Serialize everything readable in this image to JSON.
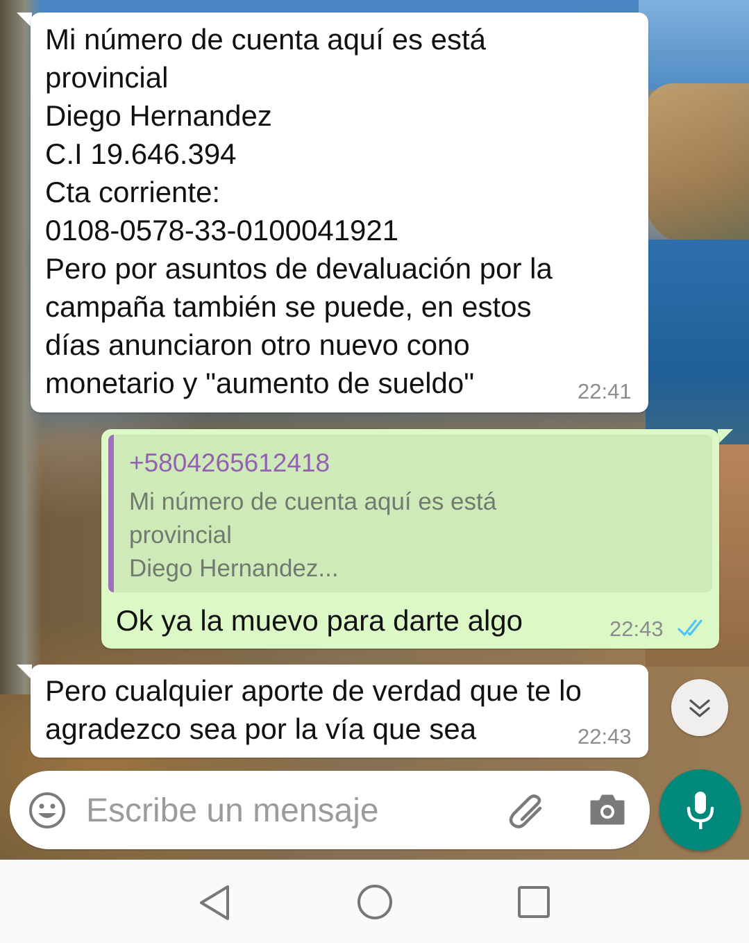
{
  "messages": [
    {
      "direction": "incoming",
      "text": "Mi número de cuenta aquí es  está\nprovincial\nDiego Hernandez\nC.I 19.646.394\nCta corriente:\n0108-0578-33-0100041921\nPero por asuntos de devaluación por la\ncampaña también se puede, en estos\ndías anunciaron otro nuevo cono\nmonetario y \"aumento de sueldo\"",
      "time": "22:41"
    },
    {
      "direction": "outgoing",
      "quote": {
        "sender": "+5804265612418",
        "text": "Mi número de cuenta aquí es  está\nprovincial\nDiego Hernandez..."
      },
      "text": "Ok ya la muevo para darte algo",
      "time": "22:43",
      "status": "read"
    },
    {
      "direction": "incoming",
      "text": "Pero cualquier aporte de verdad que te lo\nagradezco sea por la vía que sea",
      "time": "22:43"
    }
  ],
  "composer": {
    "placeholder": "Escribe un mensaje",
    "icons": [
      "emoji-icon",
      "attach-icon",
      "camera-icon",
      "mic-icon"
    ]
  },
  "scroll_button_icon": "double-chevron-down-icon",
  "nav_bar": {
    "icons": [
      "back-icon",
      "home-icon",
      "recents-icon"
    ]
  },
  "colors": {
    "incoming_bubble": "#ffffff",
    "outgoing_bubble": "#dcf8c6",
    "quote_accent": "#9b72b7",
    "read_ticks": "#4fc3f7",
    "mic_button": "#00897b"
  }
}
